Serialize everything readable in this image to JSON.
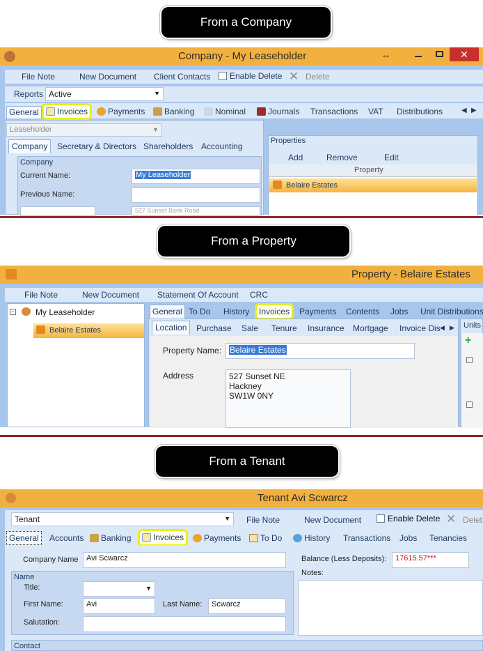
{
  "callouts": {
    "company": "From a Company",
    "property": "From a Property",
    "tenant": "From a Tenant"
  },
  "company": {
    "title": "Company - My Leaseholder",
    "resize_glyph": "↔",
    "toolbar": {
      "file_note": "File Note",
      "new_document": "New Document",
      "client_contacts": "Client Contacts",
      "enable_delete": "Enable Delete",
      "delete": "Delete"
    },
    "reports_label": "Reports",
    "reports_value": "Active",
    "tabs": [
      "General",
      "Invoices",
      "Payments",
      "Banking",
      "Nominal",
      "Journals",
      "Transactions",
      "VAT",
      "Distributions"
    ],
    "type_value": "Leaseholder",
    "subtabs": [
      "Company",
      "Secretary & Directors",
      "Shareholders",
      "Accounting"
    ],
    "group_title": "Company",
    "current_name_label": "Current Name:",
    "current_name_value": "My Leaseholder",
    "previous_name_label": "Previous Name:",
    "address_partial": "527 Sunset Bank Road",
    "properties": {
      "title": "Properties",
      "add": "Add",
      "remove": "Remove",
      "edit": "Edit",
      "column": "Property",
      "row": "Belaire Estates"
    }
  },
  "property": {
    "title": "Property - Belaire Estates",
    "toolbar": {
      "file_note": "File Note",
      "new_document": "New Document",
      "statement": "Statement Of Account",
      "crc": "CRC"
    },
    "tree": {
      "root": "My Leaseholder",
      "child": "Belaire Estates"
    },
    "tabs": [
      "General",
      "To Do",
      "History",
      "Invoices",
      "Payments",
      "Contents",
      "Jobs",
      "Unit Distributions"
    ],
    "subtabs": [
      "Location",
      "Purchase",
      "Sale",
      "Tenure",
      "Insurance",
      "Mortgage",
      "Invoice Dis"
    ],
    "name_label": "Property Name:",
    "name_value": "Belaire Estates",
    "address_label": "Address",
    "address_lines": [
      "527 Sunset NE",
      "Hackney",
      "SW1W 0NY"
    ],
    "units_label": "Units"
  },
  "tenant": {
    "title": "Tenant Avi Scwarcz",
    "type_value": "Tenant",
    "toolbar": {
      "file_note": "File Note",
      "new_document": "New Document",
      "enable_delete": "Enable Delete",
      "delete": "Delet"
    },
    "tabs": [
      "General",
      "Accounts",
      "Banking",
      "Invoices",
      "Payments",
      "To Do",
      "History",
      "Transactions",
      "Jobs",
      "Tenancies"
    ],
    "company_name_label": "Company Name",
    "company_name_value": "Avi Scwarcz",
    "balance_label": "Balance (Less Deposits):",
    "balance_value": "17615.57***",
    "notes_label": "Notes:",
    "name_group": "Name",
    "title_label": "Title:",
    "first_name_label": "First Name:",
    "first_name_value": "Avi",
    "last_name_label": "Last Name:",
    "last_name_value": "Scwarcz",
    "salutation_label": "Salutation:",
    "contact_group": "Contact"
  },
  "colors": {
    "titlebar": "#f2b13e",
    "highlight": "#e8ee1a",
    "selected_row": "#f6b43e",
    "balance": "#d0101a"
  }
}
